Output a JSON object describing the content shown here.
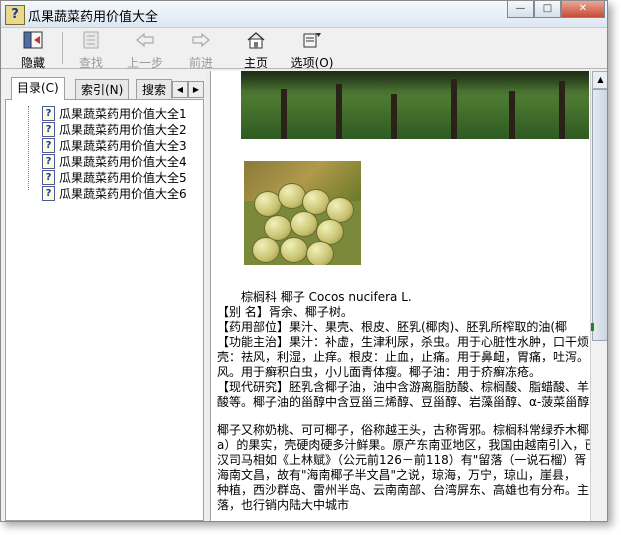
{
  "window": {
    "title": "瓜果蔬菜药用价值大全"
  },
  "toolbar": {
    "hide_label": "隐藏",
    "find_label": "查找",
    "back_label": "上一步",
    "forward_label": "前进",
    "home_label": "主页",
    "options_label": "选项(O)"
  },
  "nav": {
    "tabs": [
      {
        "label": "目录(C)",
        "active": true
      },
      {
        "label": "索引(N)",
        "active": false
      },
      {
        "label": "搜索",
        "active": false
      }
    ],
    "items": [
      "瓜果蔬菜药用价值大全1",
      "瓜果蔬菜药用价值大全2",
      "瓜果蔬菜药用价值大全3",
      "瓜果蔬菜药用价值大全4",
      "瓜果蔬菜药用价值大全5",
      "瓜果蔬菜药用价值大全6"
    ]
  },
  "content": {
    "heading": "棕榈科  椰子  Cocos nucifera L.",
    "lines": [
      "【别  名】胥余、椰子树。",
      "【药用部位】果汁、果壳、根皮、胚乳(椰肉)、胚乳所榨取的油(椰",
      "【功能主治】果汁：补虚，生津利尿，杀虫。用于心脏性水肿，口干烦",
      "壳：祛风，利湿，止痒。根皮：止血，止痛。用于鼻衄，胃痛，吐泻。",
      "风。用于癣积白虫，小儿面青体瘦。椰子油：用于疥癣冻疮。",
      "【现代研究】胚乳含椰子油，油中含游离脂肪酸、棕榈酸、脂蜡酸、羊",
      "酸等。椰子油的甾醇中含豆甾三烯醇、豆甾醇、岩藻甾醇、α-菠菜甾醇"
    ],
    "para": [
      "椰子又称奶桃、可可椰子，俗称越王头，古称胥邪。棕榈科常绿乔木椰",
      "a）的果实，壳硬肉硬多汁鲜果。原产东南亚地区，我国由越南引入，已",
      "汉司马相如《上林赋》（公元前126－前118）有\"留落（一说石榴）胥",
      "海南文昌，故有\"海南椰子半文昌\"之说，琼海，万宁，琼山，崖县，",
      "种植，西沙群岛、雷州半岛、云南南部、台湾屏东、高雄也有分布。主",
      "落，也行销内陆大中城市"
    ]
  },
  "colors": {
    "title_gradient_top": "#f4f8fc",
    "close_button": "#c84b33",
    "scroll_grip": "#2e7a2e"
  }
}
